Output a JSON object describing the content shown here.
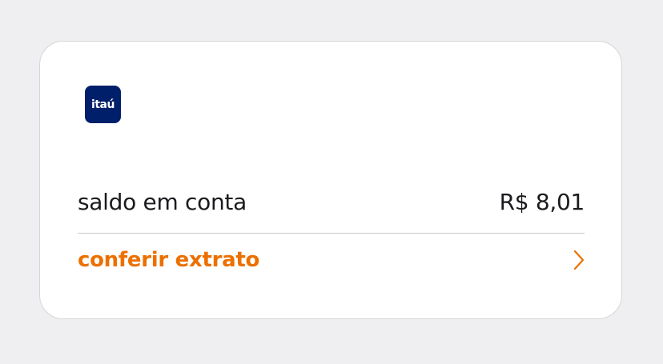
{
  "logo": {
    "text": "itaú",
    "color": "#001f6b"
  },
  "balance": {
    "label": "saldo em conta",
    "value": "R$ 8,01"
  },
  "statement_link": {
    "label": "conferir extrato",
    "color": "#ec7000",
    "icon": "chevron-right-icon"
  }
}
